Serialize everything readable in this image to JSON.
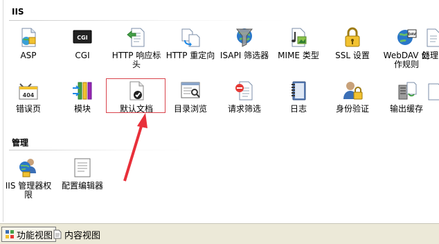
{
  "sections": {
    "iis": "IIS",
    "management": "管理"
  },
  "iis_row1": [
    {
      "label": "ASP",
      "icon": "asp-icon"
    },
    {
      "label": "CGI",
      "icon": "cgi-icon"
    },
    {
      "label": "HTTP 响应标头",
      "icon": "http-response-headers-icon"
    },
    {
      "label": "HTTP 重定向",
      "icon": "http-redirect-icon"
    },
    {
      "label": "ISAPI 筛选器",
      "icon": "isapi-filters-icon"
    },
    {
      "label": "MIME 类型",
      "icon": "mime-types-icon"
    },
    {
      "label": "SSL 设置",
      "icon": "ssl-lock-icon"
    },
    {
      "label": "WebDAV 创作规则",
      "icon": "webdav-icon"
    },
    {
      "label": "处理",
      "icon": "handler-icon"
    }
  ],
  "iis_row2": [
    {
      "label": "错误页",
      "icon": "error-pages-icon"
    },
    {
      "label": "模块",
      "icon": "modules-icon"
    },
    {
      "label": "默认文档",
      "icon": "default-document-icon"
    },
    {
      "label": "目录浏览",
      "icon": "directory-browsing-icon"
    },
    {
      "label": "请求筛选",
      "icon": "request-filtering-icon"
    },
    {
      "label": "日志",
      "icon": "logging-icon"
    },
    {
      "label": "身份验证",
      "icon": "authentication-icon"
    },
    {
      "label": "输出缓存",
      "icon": "output-caching-icon"
    },
    {
      "label": "",
      "icon": "partial-icon"
    }
  ],
  "management_row": [
    {
      "label": "IIS 管理器权限",
      "icon": "iis-manager-permissions-icon"
    },
    {
      "label": "配置编辑器",
      "icon": "configuration-editor-icon"
    }
  ],
  "tabs": {
    "features_view": "功能视图",
    "content_view": "内容视图"
  },
  "icon_text": {
    "cgi": "CGI",
    "error_404": "404",
    "dav": "DAV"
  },
  "colors": {
    "highlight": "#d9434c",
    "tab_background": "#ece9d8"
  }
}
